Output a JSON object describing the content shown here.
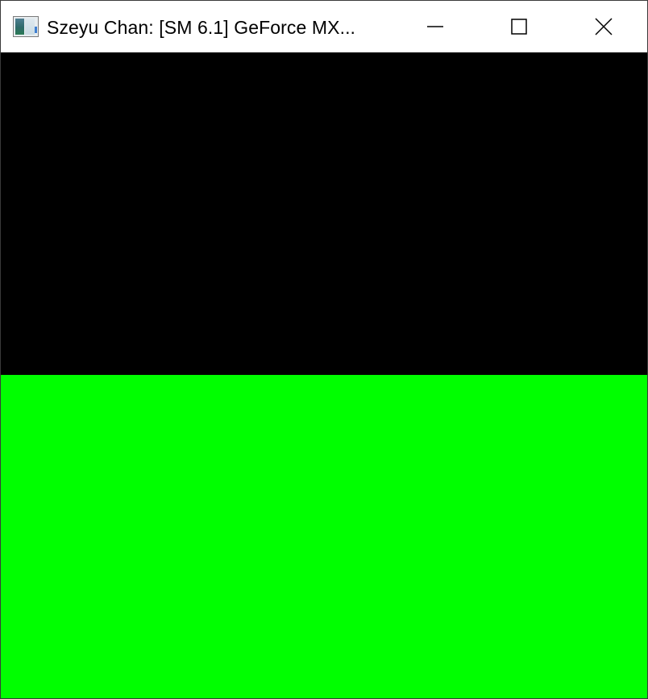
{
  "window": {
    "title": "Szeyu Chan: [SM 6.1] GeForce MX...",
    "app_icon": "app-window-icon",
    "controls": [
      {
        "name": "minimize",
        "icon": "minimize-icon"
      },
      {
        "name": "maximize",
        "icon": "maximize-icon"
      },
      {
        "name": "close",
        "icon": "close-icon"
      }
    ]
  },
  "viewport": {
    "upper_color": "#000000",
    "lower_color": "#00ff00"
  }
}
